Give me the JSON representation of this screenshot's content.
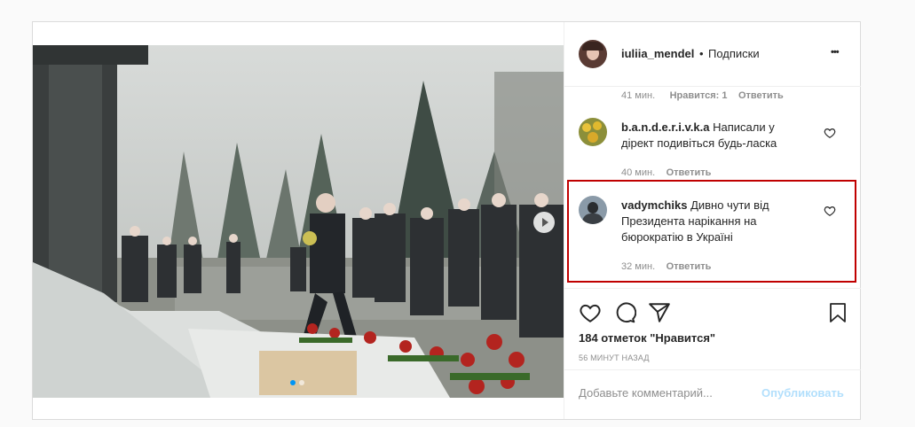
{
  "post": {
    "username": "iuliia_mendel",
    "separator": "•",
    "follow_label": "Подписки",
    "more_label": "•••"
  },
  "comments": [
    {
      "time": "41 мин.",
      "likes": "Нравится: 1",
      "reply": "Ответить"
    },
    {
      "user": "b.a.n.d.e.r.i.v.k.a",
      "text_line1": "Написали у",
      "text_line2": "дірект подивіться будь-ласка",
      "time": "40 мин.",
      "reply": "Ответить"
    },
    {
      "user": "vadymchiks",
      "text_line1": "Дивно чути від",
      "text_line2": "Президента нарікання на",
      "text_line3": "бюрократію в Україні",
      "time": "32 мин.",
      "reply": "Ответить"
    }
  ],
  "stats": {
    "likes": "184 отметок \"Нравится\"",
    "posted": "56 МИНУТ НАЗАД"
  },
  "composer": {
    "placeholder": "Добавьте комментарий...",
    "publish": "Опубликовать"
  },
  "carousel": {
    "dots": 2,
    "active": 0
  },
  "colors": {
    "highlight": "#c00000",
    "link": "#b2dffc",
    "muted": "#8e8e8e",
    "text": "#262626"
  },
  "icons": [
    "heart-icon",
    "comment-icon",
    "share-icon",
    "bookmark-icon",
    "next-arrow-icon",
    "more-icon"
  ]
}
